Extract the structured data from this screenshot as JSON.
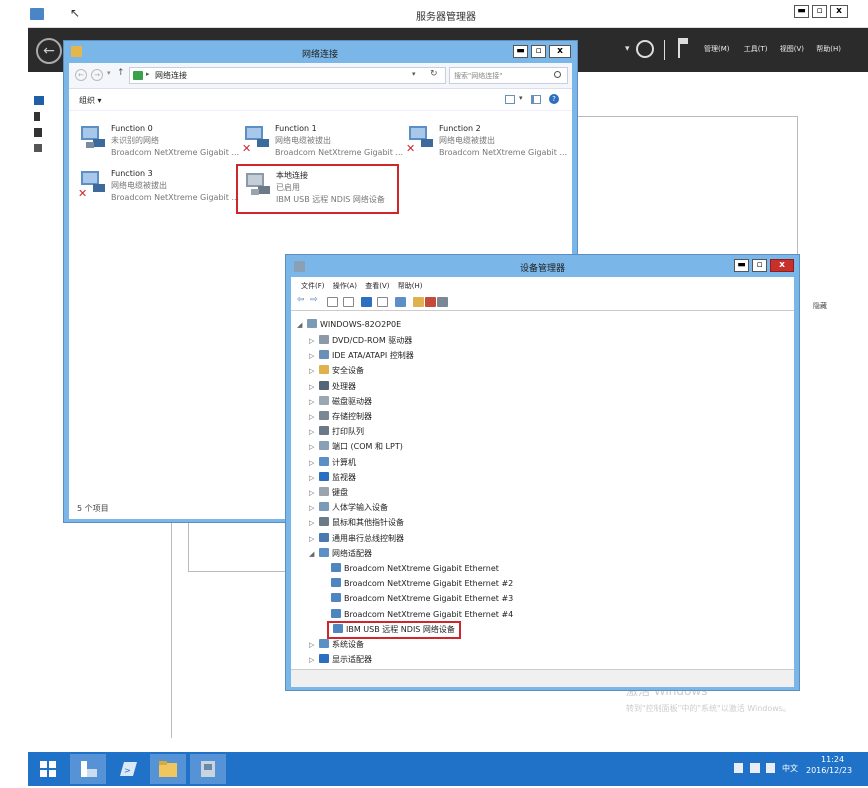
{
  "server_manager": {
    "title": "服务器管理器",
    "menu": [
      "管理(M)",
      "工具(T)",
      "视图(V)",
      "帮助(H)"
    ],
    "right_panel_text": "隐藏",
    "watermark_line1": "激活 Windows",
    "watermark_line2": "转到\"控制面板\"中的\"系统\"以激活 Windows。"
  },
  "network_window": {
    "title": "网络连接",
    "breadcrumb": "网络连接",
    "search_placeholder": "搜索\"网络连接\"",
    "organize_label": "组织 ▾",
    "status_count": "5 个项目",
    "adapters": [
      {
        "name": "Function 0",
        "status": "未识别的网络",
        "device": "Broadcom NetXtreme Gigabit ..."
      },
      {
        "name": "Function 1",
        "status": "网络电缆被拔出",
        "device": "Broadcom NetXtreme Gigabit ..."
      },
      {
        "name": "Function 2",
        "status": "网络电缆被拔出",
        "device": "Broadcom NetXtreme Gigabit ..."
      },
      {
        "name": "Function 3",
        "status": "网络电缆被拔出",
        "device": "Broadcom NetXtreme Gigabit ..."
      },
      {
        "name": "本地连接",
        "status": "已启用",
        "device": "IBM USB 远程 NDIS 网络设备"
      }
    ]
  },
  "device_manager": {
    "title": "设备管理器",
    "menu": [
      "文件(F)",
      "操作(A)",
      "查看(V)",
      "帮助(H)"
    ],
    "root": "WINDOWS-82O2P0E",
    "categories_before": [
      "DVD/CD-ROM 驱动器",
      "IDE ATA/ATAPI 控制器",
      "安全设备",
      "处理器",
      "磁盘驱动器",
      "存储控制器",
      "打印队列",
      "端口 (COM 和 LPT)",
      "计算机",
      "监视器",
      "键盘",
      "人体学输入设备",
      "鼠标和其他指针设备",
      "通用串行总线控制器",
      "网络适配器"
    ],
    "network_adapters": [
      "Broadcom NetXtreme Gigabit Ethernet",
      "Broadcom NetXtreme Gigabit Ethernet #2",
      "Broadcom NetXtreme Gigabit Ethernet #3",
      "Broadcom NetXtreme Gigabit Ethernet #4",
      "IBM USB 远程 NDIS 网络设备"
    ],
    "categories_after": [
      "系统设备",
      "显示适配器"
    ]
  },
  "taskbar": {
    "lang": "中文",
    "time": "11:24",
    "date": "2016/12/23"
  },
  "colors": {
    "server_manager_bar": "#2b2b2b",
    "taskbar": "#1f72c8",
    "highlight_border": "#d0262b",
    "window_frame": "#7ab6e8"
  }
}
